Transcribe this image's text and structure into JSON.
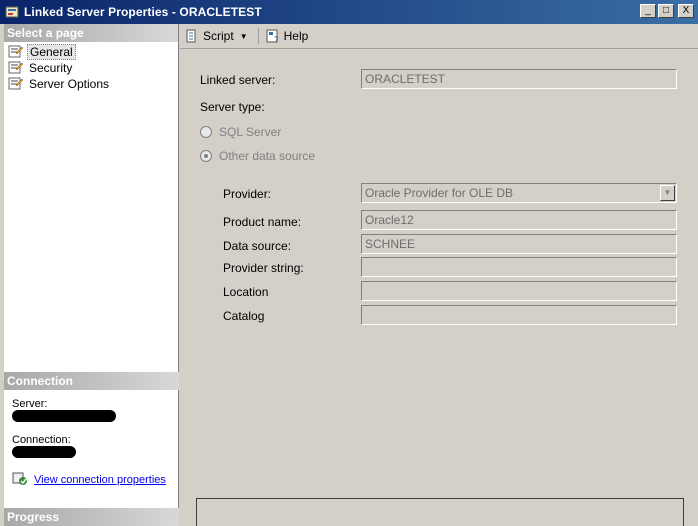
{
  "window": {
    "title": "Linked Server Properties - ORACLETEST",
    "minimize": "_",
    "maximize": "□",
    "close": "X"
  },
  "left": {
    "select_page_header": "Select a page",
    "pages": [
      {
        "label": "General",
        "selected": true
      },
      {
        "label": "Security",
        "selected": false
      },
      {
        "label": "Server Options",
        "selected": false
      }
    ],
    "connection_header": "Connection",
    "server_label": "Server:",
    "connection_label": "Connection:",
    "view_connection_link": "View connection properties",
    "progress_header": "Progress"
  },
  "toolbar": {
    "script_label": "Script",
    "help_label": "Help"
  },
  "form": {
    "linked_server_label": "Linked server:",
    "linked_server_value": "ORACLETEST",
    "server_type_label": "Server type:",
    "sql_server_option": "SQL Server",
    "other_source_option": "Other data source",
    "provider_label": "Provider:",
    "provider_value": "Oracle Provider for OLE DB",
    "product_name_label": "Product name:",
    "product_name_value": "Oracle12",
    "data_source_label": "Data source:",
    "data_source_value": "SCHNEE",
    "provider_string_label": "Provider string:",
    "provider_string_value": "",
    "location_label": "Location",
    "location_value": "",
    "catalog_label": "Catalog",
    "catalog_value": ""
  }
}
